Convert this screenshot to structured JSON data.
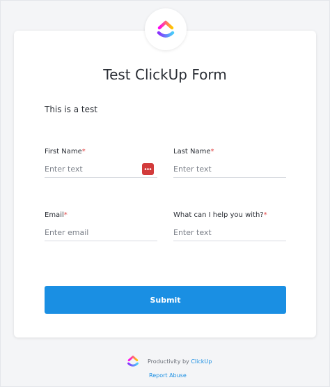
{
  "form": {
    "title": "Test ClickUp Form",
    "description": "This is a test",
    "fields": [
      {
        "label": "First Name",
        "required_mark": "*",
        "placeholder": "Enter text"
      },
      {
        "label": "Last Name",
        "required_mark": "*",
        "placeholder": "Enter text"
      },
      {
        "label": "Email",
        "required_mark": "*",
        "placeholder": "Enter email"
      },
      {
        "label": "What can I help you with?",
        "required_mark": "*",
        "placeholder": "Enter text"
      }
    ],
    "submit_label": "Submit"
  },
  "footer": {
    "prefix": "Productivity by",
    "brand_link": "ClickUp",
    "report_abuse": "Report Abuse"
  },
  "icons": {
    "logo": "clickup-logo-icon",
    "password_manager": "password-manager-icon"
  },
  "colors": {
    "accent": "#1a8fe3",
    "required": "#e04545",
    "password_icon_bg": "#d23b3b"
  }
}
